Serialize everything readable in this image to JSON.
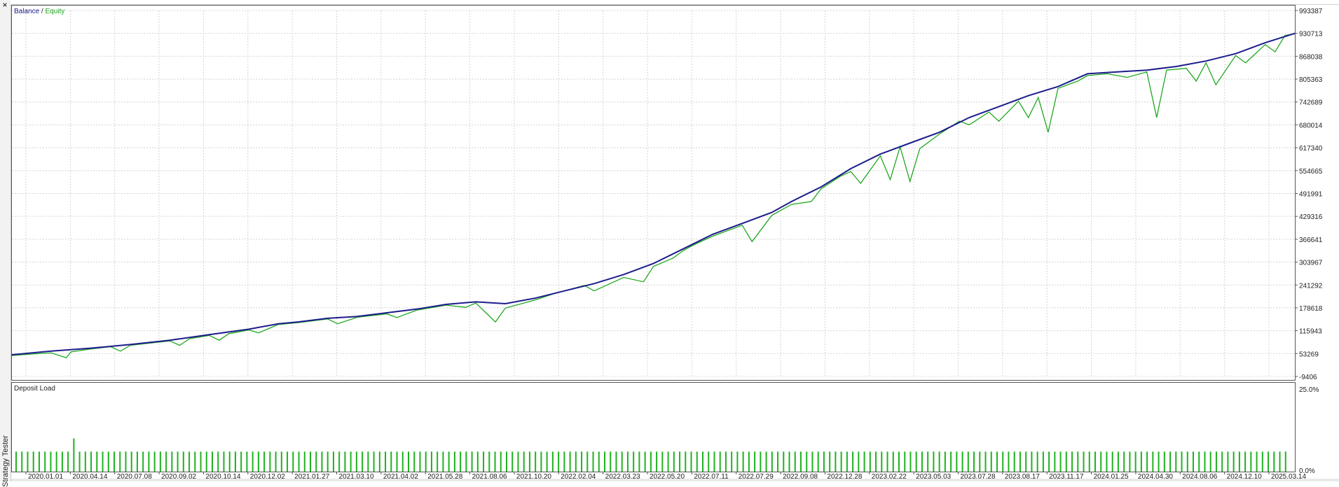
{
  "panel": {
    "side_title": "Strategy Tester",
    "close_glyph": "×"
  },
  "chart_data": [
    {
      "type": "line",
      "series": [
        {
          "name": "Balance",
          "color": "#1c1c8c",
          "values": [
            [
              0,
              50000
            ],
            [
              4,
              60000
            ],
            [
              8,
              68000
            ],
            [
              12,
              78000
            ],
            [
              16,
              90000
            ],
            [
              20,
              105000
            ],
            [
              24,
              120000
            ],
            [
              27,
              135000
            ],
            [
              29,
              140000
            ],
            [
              32,
              150000
            ],
            [
              35,
              155000
            ],
            [
              38,
              165000
            ],
            [
              41,
              175000
            ],
            [
              44,
              188000
            ],
            [
              47,
              195000
            ],
            [
              50,
              190000
            ],
            [
              53,
              205000
            ],
            [
              56,
              225000
            ],
            [
              59,
              245000
            ],
            [
              62,
              270000
            ],
            [
              65,
              300000
            ],
            [
              68,
              340000
            ],
            [
              71,
              380000
            ],
            [
              74,
              410000
            ],
            [
              77,
              440000
            ],
            [
              79,
              470000
            ],
            [
              82,
              510000
            ],
            [
              85,
              560000
            ],
            [
              88,
              600000
            ],
            [
              91,
              630000
            ],
            [
              94,
              660000
            ],
            [
              97,
              700000
            ],
            [
              100,
              730000
            ],
            [
              103,
              760000
            ],
            [
              106,
              785000
            ],
            [
              109,
              820000
            ],
            [
              112,
              825000
            ],
            [
              115,
              830000
            ],
            [
              118,
              840000
            ],
            [
              121,
              855000
            ],
            [
              124,
              875000
            ],
            [
              127,
              905000
            ],
            [
              130,
              930713
            ]
          ]
        },
        {
          "name": "Equity",
          "color": "#1fa81f",
          "values": [
            [
              0,
              48000
            ],
            [
              2,
              52000
            ],
            [
              4,
              55000
            ],
            [
              5.5,
              42000
            ],
            [
              6,
              58000
            ],
            [
              8,
              66000
            ],
            [
              10,
              72000
            ],
            [
              11,
              60000
            ],
            [
              12,
              76000
            ],
            [
              14,
              82000
            ],
            [
              16,
              88000
            ],
            [
              17,
              76000
            ],
            [
              18,
              94000
            ],
            [
              20,
              103000
            ],
            [
              21,
              90000
            ],
            [
              22,
              108000
            ],
            [
              24,
              118000
            ],
            [
              25,
              110000
            ],
            [
              27,
              133000
            ],
            [
              29,
              138000
            ],
            [
              32,
              148000
            ],
            [
              33,
              135000
            ],
            [
              35,
              153000
            ],
            [
              38,
              162000
            ],
            [
              39,
              152000
            ],
            [
              41,
              172000
            ],
            [
              44,
              186000
            ],
            [
              46,
              180000
            ],
            [
              47,
              192000
            ],
            [
              49,
              140000
            ],
            [
              50,
              178000
            ],
            [
              53,
              200000
            ],
            [
              55,
              218000
            ],
            [
              58,
              240000
            ],
            [
              59,
              225000
            ],
            [
              62,
              262000
            ],
            [
              64,
              250000
            ],
            [
              65,
              292000
            ],
            [
              67,
              315000
            ],
            [
              68,
              335000
            ],
            [
              69,
              350000
            ],
            [
              71,
              375000
            ],
            [
              73,
              395000
            ],
            [
              74,
              405000
            ],
            [
              75,
              360000
            ],
            [
              77,
              432000
            ],
            [
              79,
              462000
            ],
            [
              81,
              470000
            ],
            [
              82,
              505000
            ],
            [
              84,
              540000
            ],
            [
              85,
              552000
            ],
            [
              86,
              520000
            ],
            [
              88,
              595000
            ],
            [
              89,
              530000
            ],
            [
              90,
              620000
            ],
            [
              91,
              525000
            ],
            [
              92,
              615000
            ],
            [
              94,
              655000
            ],
            [
              96,
              690000
            ],
            [
              97,
              680000
            ],
            [
              99,
              715000
            ],
            [
              100,
              690000
            ],
            [
              102,
              745000
            ],
            [
              103,
              700000
            ],
            [
              104,
              755000
            ],
            [
              105,
              660000
            ],
            [
              106,
              780000
            ],
            [
              108,
              800000
            ],
            [
              109,
              815000
            ],
            [
              111,
              820000
            ],
            [
              113,
              810000
            ],
            [
              115,
              825000
            ],
            [
              116,
              700000
            ],
            [
              117,
              830000
            ],
            [
              119,
              835000
            ],
            [
              120,
              800000
            ],
            [
              121,
              850000
            ],
            [
              122,
              790000
            ],
            [
              124,
              870000
            ],
            [
              125,
              850000
            ],
            [
              127,
              900000
            ],
            [
              128,
              880000
            ],
            [
              129,
              925000
            ],
            [
              130,
              930000
            ]
          ]
        }
      ],
      "legend": [
        "Balance",
        "Equity"
      ],
      "legend_separator": " / ",
      "y_ticks": [
        "993387",
        "930713",
        "868038",
        "805363",
        "742689",
        "680014",
        "617340",
        "554665",
        "491991",
        "429316",
        "366641",
        "303967",
        "241292",
        "178618",
        "115943",
        "53269",
        "-9406"
      ],
      "ylim": [
        -9406,
        993387
      ],
      "x_ticks": [
        "2020.01.01",
        "2020.04.14",
        "2020.07.08",
        "2020.09.02",
        "2020.10.14",
        "2020.12.02",
        "2021.01.27",
        "2021.03.10",
        "2021.04.02",
        "2021.05.28",
        "2021.08.06",
        "2021.10.20",
        "2022.02.04",
        "2022.03.23",
        "2022.05.20",
        "2022.07.11",
        "2022.07.29",
        "2022.09.08",
        "2022.12.28",
        "2023.02.22",
        "2023.05.03",
        "2023.07.28",
        "2023.08.17",
        "2023.11.17",
        "2024.01.25",
        "2024.04.30",
        "2024.08.06",
        "2024.12.10",
        "2025.03.14"
      ],
      "xlim": [
        0,
        130
      ],
      "grid": true
    },
    {
      "type": "bar",
      "title": "Deposit Load",
      "y_ticks": [
        "25.0%",
        "0.0%"
      ],
      "ylim": [
        0,
        25
      ],
      "unit": "%",
      "color": "#1fb21f",
      "values": [
        6,
        6,
        6,
        6,
        6,
        6,
        6,
        6,
        6,
        6,
        10,
        6,
        6,
        6,
        6,
        6,
        6,
        6,
        6,
        6,
        6,
        6,
        6,
        6,
        6,
        6,
        6,
        6,
        6,
        6,
        6,
        6,
        6,
        6,
        6,
        6,
        6,
        6,
        6,
        6,
        6,
        6,
        6,
        6,
        6,
        6,
        6,
        6,
        6,
        6,
        6,
        6,
        6,
        6,
        6,
        6,
        6,
        6,
        6,
        6,
        6,
        6,
        6,
        6,
        6,
        6,
        6,
        6,
        6,
        6,
        6,
        6,
        6,
        6,
        6,
        6,
        6,
        6,
        6,
        6,
        6,
        6,
        6,
        6,
        6,
        6,
        6,
        6,
        6,
        6,
        6,
        6,
        6,
        6,
        6,
        6,
        6,
        6,
        6,
        6,
        6,
        6,
        6,
        6,
        6,
        6,
        6,
        6,
        6,
        6,
        6,
        6,
        6,
        6,
        6,
        6,
        6,
        6,
        6,
        6,
        6,
        6,
        6,
        6,
        6,
        6,
        6,
        6,
        6,
        6,
        6,
        6,
        6,
        6,
        6,
        6,
        6,
        6,
        6,
        6,
        6,
        6,
        6,
        6,
        6,
        6,
        6,
        6,
        6,
        6,
        6,
        6,
        6,
        6,
        6,
        6,
        6,
        6,
        6,
        6,
        6,
        6,
        6,
        6,
        6,
        6,
        6,
        6,
        6,
        6,
        6,
        6,
        6,
        6,
        6,
        6,
        6,
        6,
        6,
        6,
        6,
        6,
        6,
        6,
        6,
        6,
        6,
        6,
        6,
        6,
        6,
        6,
        6,
        6,
        6,
        6,
        6,
        6,
        6,
        6,
        6,
        6,
        6,
        6,
        6,
        6,
        6,
        6,
        6,
        6,
        6,
        6,
        6,
        6,
        6,
        6,
        6,
        6,
        6,
        6,
        6
      ]
    }
  ]
}
